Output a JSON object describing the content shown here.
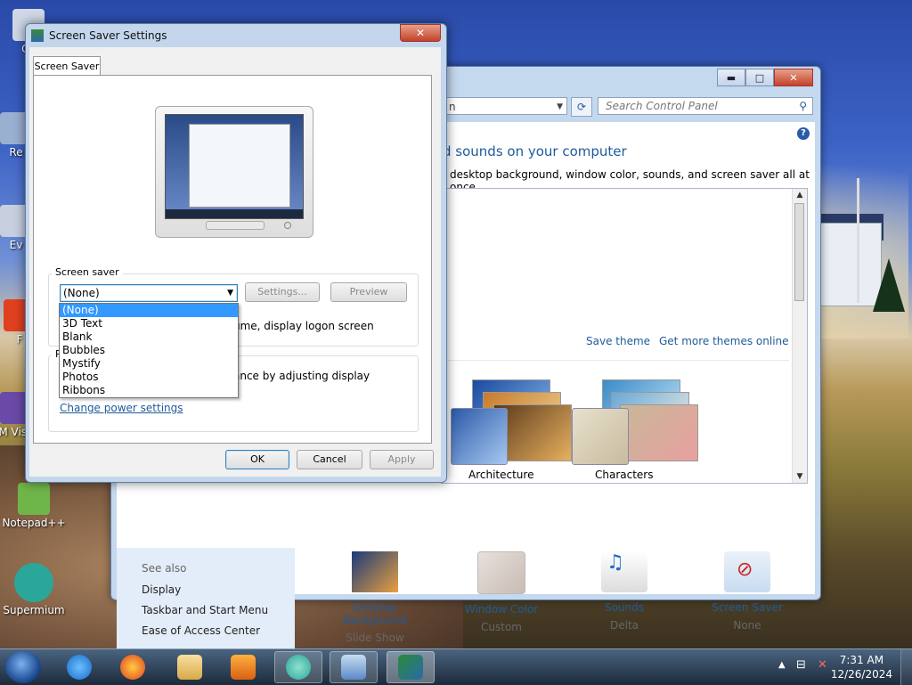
{
  "desktop": {
    "icons": [
      {
        "label": "Co",
        "color": "#d0d8e8"
      },
      {
        "label": "Re",
        "color": "#9ab0d0"
      },
      {
        "label": "Ev",
        "color": "#c8d0e0"
      },
      {
        "label": "F",
        "color": "#e04020"
      },
      {
        "label": "M Visu",
        "color": "#6a4aa8"
      },
      {
        "label": "Notepad++",
        "color": "#6fb64a"
      },
      {
        "label": "Supermium",
        "color": "#2aa79a"
      }
    ]
  },
  "personalization": {
    "window_buttons": {
      "minimize": "▬",
      "maximize": "□",
      "close": "✕"
    },
    "address_text": "n",
    "search_placeholder": "Search Control Panel",
    "heading": "d sounds on your computer",
    "subheading": "desktop background, window color, sounds, and screen saver all at once.",
    "save_theme": "Save theme",
    "get_more_themes": "Get more themes online",
    "themes": [
      {
        "name": "Architecture"
      },
      {
        "name": "Characters"
      }
    ],
    "see_also": {
      "heading": "See also",
      "items": [
        "Display",
        "Taskbar and Start Menu",
        "Ease of Access Center"
      ]
    },
    "bottom_items": [
      {
        "label": "Desktop Background",
        "value": "Slide Show",
        "icon": "desktop-background-icon"
      },
      {
        "label": "Window Color",
        "value": "Custom",
        "icon": "window-color-icon"
      },
      {
        "label": "Sounds",
        "value": "Delta",
        "icon": "sounds-icon"
      },
      {
        "label": "Screen Saver",
        "value": "None",
        "icon": "screen-saver-icon"
      }
    ]
  },
  "screen_saver_dialog": {
    "title": "Screen Saver Settings",
    "close": "✕",
    "tab": "Screen Saver",
    "group_label": "Screen saver",
    "selected": "(None)",
    "settings_button": "Settings...",
    "preview_button": "Preview",
    "resume_text": "ume, display logon screen",
    "power_group_label": "P",
    "power_text": "ance by adjusting display",
    "power_link": "Change power settings",
    "options": [
      "(None)",
      "3D Text",
      "Blank",
      "Bubbles",
      "Mystify",
      "Photos",
      "Ribbons"
    ],
    "ok": "OK",
    "cancel": "Cancel",
    "apply": "Apply"
  },
  "taskbar": {
    "time": "7:31 AM",
    "date": "12/26/2024",
    "apps": [
      "internet-explorer",
      "firefox",
      "file-explorer",
      "media-player",
      "supermium",
      "control-panel",
      "screen-saver-settings"
    ]
  }
}
